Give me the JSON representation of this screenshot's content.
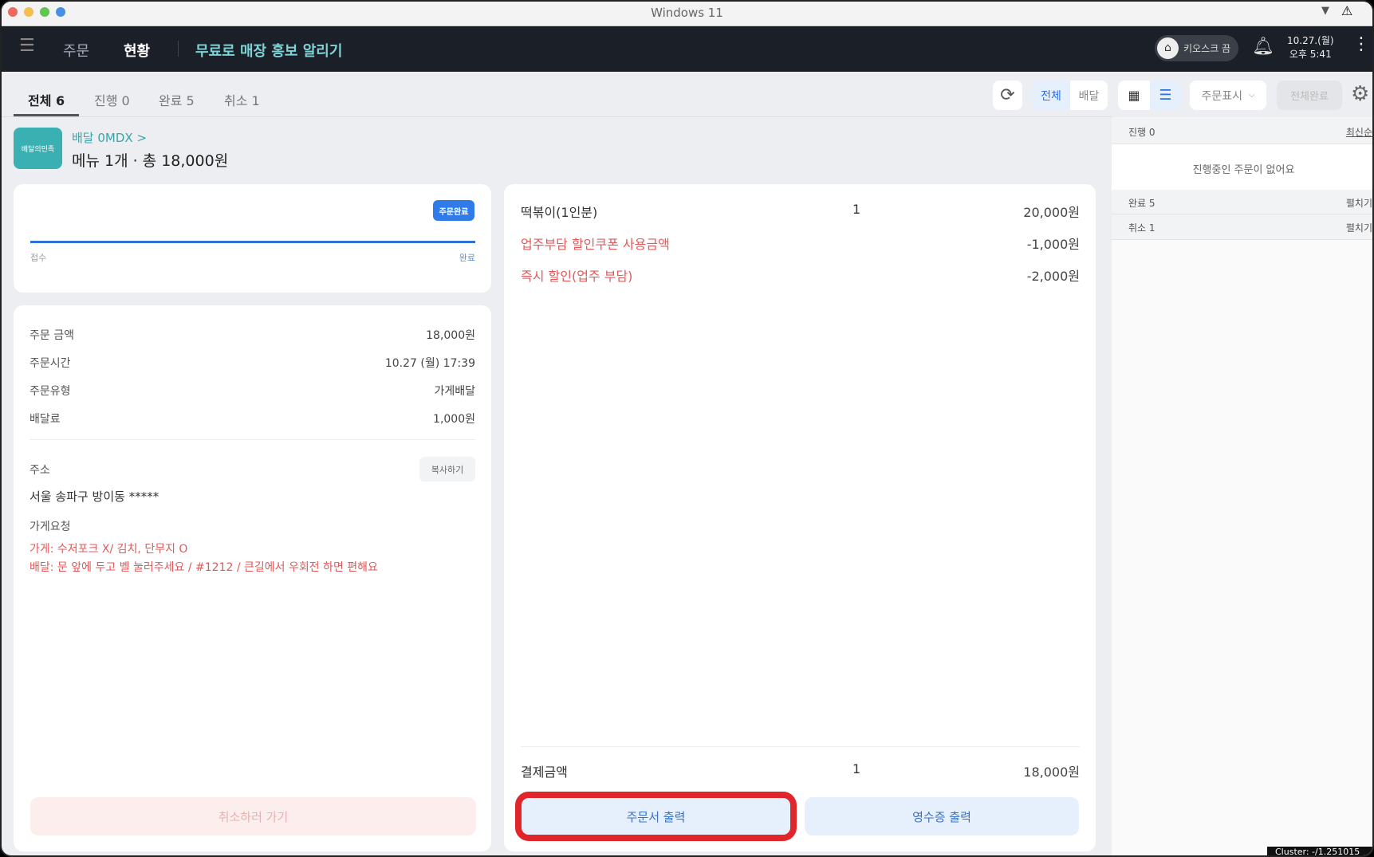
{
  "window": {
    "title": "Windows 11"
  },
  "header": {
    "nav_orders": "주문",
    "nav_status": "현황",
    "promo": "무료로 매장 홍보 알리기",
    "kiosk": "키오스크 끔",
    "date": "10.27.(월)",
    "time": "오후 5:41"
  },
  "tabs": [
    {
      "label": "전체 6"
    },
    {
      "label": "진행 0"
    },
    {
      "label": "완료 5"
    },
    {
      "label": "취소 1"
    }
  ],
  "toolbar": {
    "filter_all": "전체",
    "filter_delivery": "배달",
    "display_select": "주문표시",
    "complete_all": "전체완료"
  },
  "order": {
    "logo_text": "배달의민족",
    "id": "배달 0MDX >",
    "summary": "메뉴 1개 · 총 18,000원"
  },
  "progress": {
    "badge": "주문완료",
    "start": "접수",
    "end": "완료",
    "value": 1.0,
    "color": "#2f6fde"
  },
  "details": {
    "rows": [
      {
        "label": "주문 금액",
        "value": "18,000원"
      },
      {
        "label": "주문시간",
        "value": "10.27 (월) 17:39"
      },
      {
        "label": "주문유형",
        "value": "가게배달"
      },
      {
        "label": "배달료",
        "value": "1,000원"
      }
    ],
    "address_label": "주소",
    "copy_button": "복사하기",
    "address": "서울 송파구 방이동 *****",
    "request_label": "가게요청",
    "request_store": "가게:  수저포크 X/ 김치, 단무지 O",
    "request_delivery": "배달: 문 앞에 두고 벨 눌러주세요 / #1212  / 큰길에서 우회전 하면 편해요",
    "cancel_button": "취소하러 가기"
  },
  "items": {
    "menu": {
      "name": "떡볶이(1인분)",
      "qty": "1",
      "price": "20,000원"
    },
    "discounts": [
      {
        "name": "업주부담 할인쿠폰 사용금액",
        "price": "-1,000원"
      },
      {
        "name": "즉시 할인(업주 부담)",
        "price": "-2,000원"
      }
    ],
    "total": {
      "label": "결제금액",
      "qty": "1",
      "price": "18,000원"
    },
    "print_order": "주문서 출력",
    "print_receipt": "영수증 출력"
  },
  "sidebar": {
    "in_progress": "진행 0",
    "sort": "최신순",
    "empty": "진행중인 주문이 없어요",
    "completed": "완료 5",
    "cancelled": "취소 1",
    "expand": "펼치기"
  },
  "footer": {
    "cluster": "Cluster: -/1.251015"
  }
}
